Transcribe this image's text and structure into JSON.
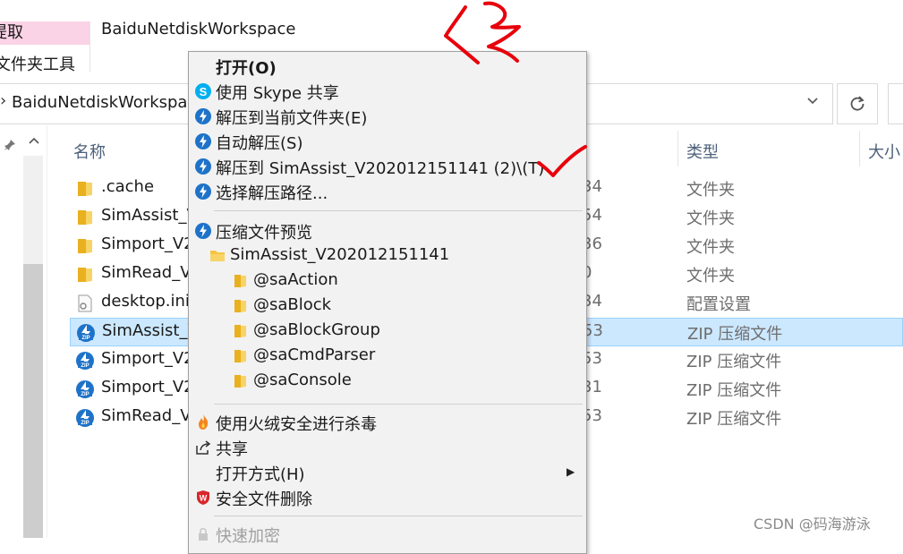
{
  "ribbon": {
    "tab_extract": "提取",
    "tab_folder_tools": "文件夹工具",
    "window_title": "BaiduNetdiskWorkspace"
  },
  "address": {
    "path": "BaiduNetdiskWorkspace",
    "dropdown_icon": "chevron-down-icon",
    "refresh_icon": "refresh-icon"
  },
  "columns": {
    "name": "名称",
    "type": "类型",
    "size": "大小"
  },
  "files": [
    {
      "name": ".cache",
      "date": "34",
      "type": "文件夹",
      "icon": "folder-icon"
    },
    {
      "name": "SimAssist_V",
      "date": "54",
      "type": "文件夹",
      "icon": "folder-icon"
    },
    {
      "name": "Simport_V2",
      "date": "36",
      "type": "文件夹",
      "icon": "folder-icon"
    },
    {
      "name": "SimRead_V",
      "date": "0",
      "type": "文件夹",
      "icon": "folder-icon"
    },
    {
      "name": "desktop.ini",
      "date": "34",
      "type": "配置设置",
      "icon": "settings-file-icon"
    },
    {
      "name": "SimAssist_V",
      "date": "53",
      "type": "ZIP 压缩文件",
      "icon": "zip-icon",
      "selected": true
    },
    {
      "name": "Simport_V2",
      "date": "53",
      "type": "ZIP 压缩文件",
      "icon": "zip-icon"
    },
    {
      "name": "Simport_V2",
      "date": "31",
      "type": "ZIP 压缩文件",
      "icon": "zip-icon"
    },
    {
      "name": "SimRead_V",
      "date": "53",
      "type": "ZIP 压缩文件",
      "icon": "zip-icon"
    }
  ],
  "menu": {
    "open": "打开(O)",
    "skype_share": "使用 Skype 共享",
    "extract_here": "解压到当前文件夹(E)",
    "auto_extract": "自动解压(S)",
    "extract_to": "解压到 SimAssist_V202012151141 (2)\\(T)",
    "choose_path": "选择解压路径...",
    "preview": "压缩文件预览",
    "preview_root": "SimAssist_V202012151141",
    "preview_children": [
      "@saAction",
      "@saBlock",
      "@saBlockGroup",
      "@saCmdParser",
      "@saConsole"
    ],
    "huorong_scan": "使用火绒安全进行杀毒",
    "share": "共享",
    "open_with": "打开方式(H)",
    "secure_delete": "安全文件删除",
    "quick_encrypt": "快速加密"
  },
  "watermark": "CSDN @码海游泳",
  "colors": {
    "accent_blue": "#1e73c8",
    "selection": "#cce8ff",
    "annotation_red": "#e8000b",
    "folder_yellow": "#f5c542"
  }
}
